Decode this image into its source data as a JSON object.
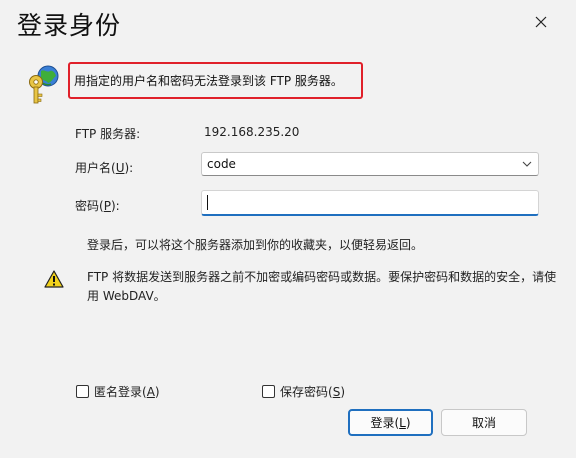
{
  "window": {
    "title": "登录身份"
  },
  "message": "用指定的用户名和密码无法登录到该 FTP 服务器。",
  "server": {
    "label": "FTP 服务器:",
    "value": "192.168.235.20"
  },
  "username": {
    "label_pre": "用户名(",
    "label_key": "U",
    "label_post": "):",
    "value": "code"
  },
  "password": {
    "label_pre": "密码(",
    "label_key": "P",
    "label_post": "):",
    "value": ""
  },
  "info_text": "登录后，可以将这个服务器添加到你的收藏夹，以便轻易返回。",
  "warning": {
    "line1": "FTP 将数据发送到服务器之前不加密或编码密码或数据。要保护密码和数据的安全，请使",
    "line2": "用 WebDAV。"
  },
  "checkboxes": {
    "anonymous": {
      "label_pre": "匿名登录(",
      "label_key": "A",
      "label_post": ")",
      "checked": false
    },
    "save_password": {
      "label_pre": "保存密码(",
      "label_key": "S",
      "label_post": ")",
      "checked": false
    }
  },
  "buttons": {
    "login": {
      "label_pre": "登录(",
      "label_key": "L",
      "label_post": ")"
    },
    "cancel": {
      "label": "取消"
    }
  },
  "colors": {
    "highlight_border": "#e0202a",
    "accent": "#1f6fbf"
  }
}
